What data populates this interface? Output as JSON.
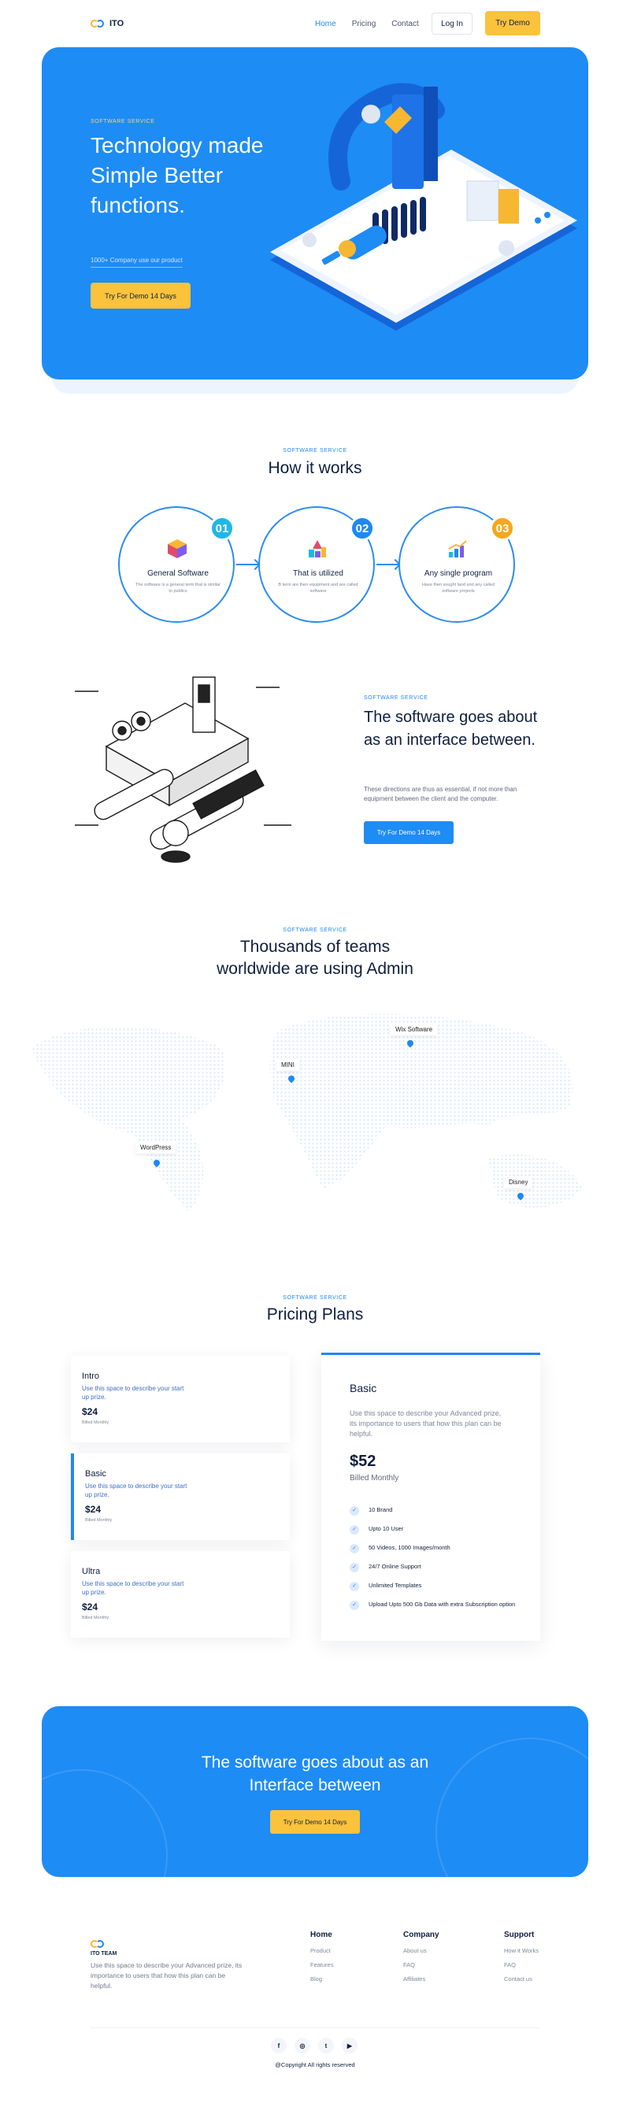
{
  "nav": {
    "brand": "ITO",
    "links": [
      {
        "label": "Home"
      },
      {
        "label": "Pricing"
      },
      {
        "label": "Contact"
      }
    ],
    "login_label": "Log In",
    "demo_label": "Try  Demo"
  },
  "hero": {
    "eyebrow": "SOFTWARE SERVICE",
    "title": "Technology made Simple Better functions.",
    "subtitle": "1000+ Company use our product",
    "cta_label": "Try For Demo 14 Days"
  },
  "how": {
    "eyebrow": "SOFTWARE SERVICE",
    "title": "How it works",
    "steps": [
      {
        "num": "01",
        "title": "General Software",
        "desc": "The software is a general term that is similar to publics",
        "color": "#1fb7e8"
      },
      {
        "num": "02",
        "title": "That is utilized",
        "desc": "B term are then equipment and are called software",
        "color": "#1e88f5"
      },
      {
        "num": "03",
        "title": "Any single program",
        "desc": "Have then sought land and any called software projects",
        "color": "#f7a81b"
      }
    ]
  },
  "interface": {
    "eyebrow": "SOFTWARE SERVICE",
    "title": "The software goes about as an interface between.",
    "text": "These directions are thus as essential, if not more than equipment  between the client and the computer.",
    "cta_label": "Try For Demo 14 Days"
  },
  "map": {
    "eyebrow": "SOFTWARE SERVICE",
    "title_line1": "Thousands of teams",
    "title_line2": "worldwide are using Admin",
    "brands": [
      {
        "label": "Wix Software"
      },
      {
        "label": "MINI"
      },
      {
        "label": "WordPress"
      },
      {
        "label": "Disney"
      }
    ]
  },
  "pricing": {
    "eyebrow": "SOFTWARE SERVICE",
    "title": "Pricing Plans",
    "plans": [
      {
        "name": "Intro",
        "desc": "Use this space to describe your start up prize.",
        "price": "$24",
        "billed": "Billed Monthly"
      },
      {
        "name": "Basic",
        "desc": "Use this space to describe your start up prize.",
        "price": "$24",
        "billed": "Billed Monthly"
      },
      {
        "name": "Ultra",
        "desc": "Use this space to describe your start up prize.",
        "price": "$24",
        "billed": "Billed Monthly"
      }
    ],
    "featured": {
      "name": "Basic",
      "desc": "Use this space to describe your Advanced prize, its importance to users that how this plan can be helpful.",
      "price": "$52",
      "billed": "Billed Monthly",
      "features": [
        "10 Brand",
        "Upto 10 User",
        "50 Videos, 1000 Images/month",
        "24/7 Online Support",
        "Unlimited Templates",
        "Upload Upto 500 Gb Data with extra Subscription option"
      ]
    }
  },
  "cta": {
    "title_line1": "The software goes about as an",
    "title_line2": "Interface between",
    "button_label": "Try For Demo 14 Days"
  },
  "footer": {
    "team": "ITO TEAM",
    "desc": "Use this space to describe your Advanced prize, its importance to users that how this plan can be helpful.",
    "columns": [
      {
        "title": "Home",
        "links": [
          "Product",
          "Features",
          "Blog"
        ]
      },
      {
        "title": "Company",
        "links": [
          "About us",
          "FAQ",
          "Affiliates"
        ]
      },
      {
        "title": "Support",
        "links": [
          "How it Works",
          "FAQ",
          "Contact us"
        ]
      }
    ],
    "socials": [
      "f",
      "◎",
      "t",
      "▶"
    ],
    "copyright": "@Copyright All rights reserved"
  },
  "colors": {
    "primary": "#1e8cf5",
    "accent": "#fbc23c",
    "text": "#0f1f3d"
  }
}
